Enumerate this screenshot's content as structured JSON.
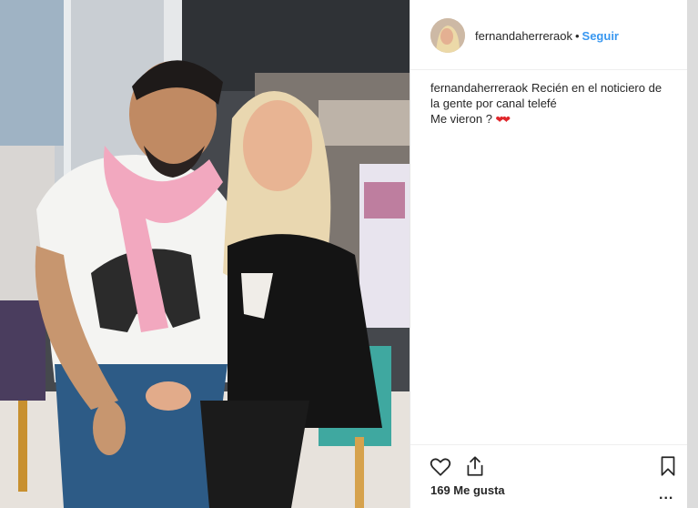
{
  "post": {
    "username": "fernandaherreraok",
    "separator": "•",
    "follow_label": "Seguir",
    "avatar_icon": "profile-avatar",
    "caption": {
      "username": "fernandaherreraok",
      "line1": "Recién en el noticiero de",
      "line2": "la gente por canal telefé",
      "line3": "Me vieron ?",
      "hearts": "❤❤"
    },
    "likes": "169 Me gusta",
    "actions": {
      "like_icon": "heart-icon",
      "share_icon": "share-icon",
      "save_icon": "bookmark-icon",
      "more_label": "..."
    }
  },
  "colors": {
    "follow": "#3897f0",
    "hearts": "#e0262b",
    "text": "#262626"
  }
}
